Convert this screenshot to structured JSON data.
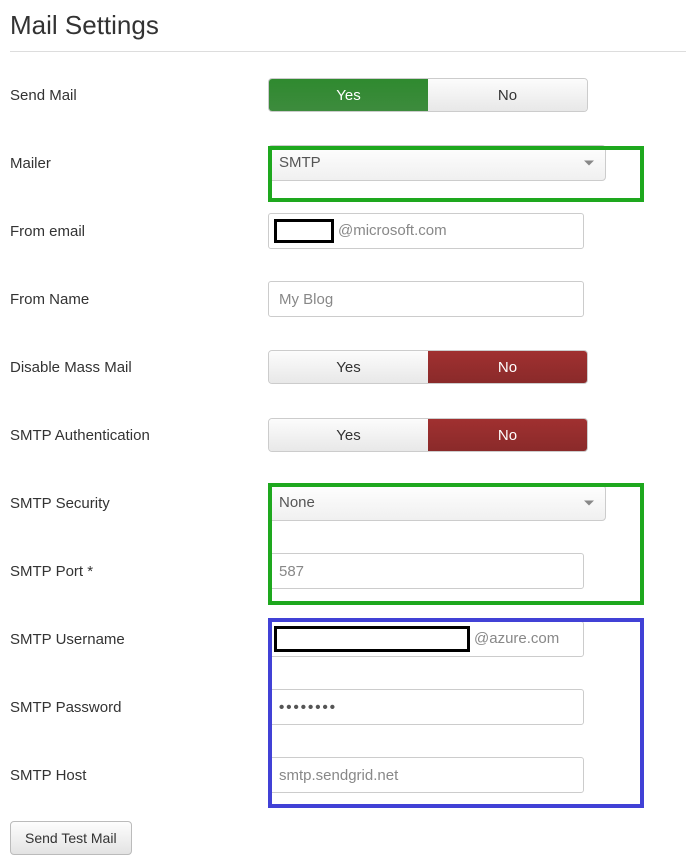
{
  "title": "Mail Settings",
  "fields": {
    "send_mail": {
      "label": "Send Mail",
      "yes": "Yes",
      "no": "No",
      "value": "yes"
    },
    "mailer": {
      "label": "Mailer",
      "selected": "SMTP"
    },
    "from_email": {
      "label": "From email",
      "suffix": "@microsoft.com"
    },
    "from_name": {
      "label": "From Name",
      "value": "My Blog"
    },
    "disable_mass_mail": {
      "label": "Disable Mass Mail",
      "yes": "Yes",
      "no": "No",
      "value": "no"
    },
    "smtp_auth": {
      "label": "SMTP Authentication",
      "yes": "Yes",
      "no": "No",
      "value": "no"
    },
    "smtp_security": {
      "label": "SMTP Security",
      "selected": "None"
    },
    "smtp_port": {
      "label": "SMTP Port *",
      "value": "587"
    },
    "smtp_username": {
      "label": "SMTP Username",
      "suffix": "@azure.com"
    },
    "smtp_password": {
      "label": "SMTP Password",
      "value": "••••••••"
    },
    "smtp_host": {
      "label": "SMTP Host",
      "value": "smtp.sendgrid.net"
    }
  },
  "send_test_button": "Send Test Mail"
}
